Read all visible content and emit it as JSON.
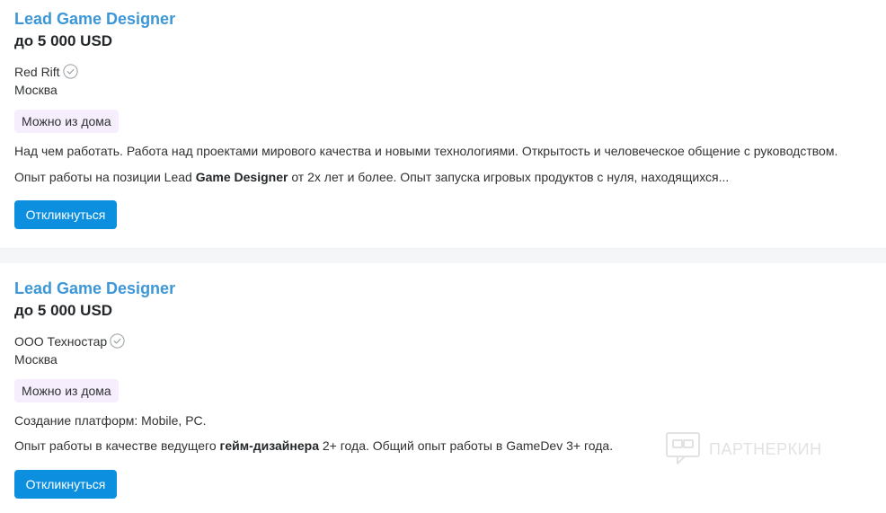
{
  "vacancies": [
    {
      "title": "Lead Game Designer",
      "salary": "до 5 000 USD",
      "company": "Red Rift",
      "city": "Москва",
      "badge": "Можно из дома",
      "line1": "Над чем работать. Работа над проектами мирового качества и новыми технологиями. Открытость и человеческое общение с руководством.",
      "line2_before": "Опыт работы на позиции Lead ",
      "line2_highlight": "Game Designer",
      "line2_after": " от 2х лет и более. Опыт запуска игровых продуктов с нуля, находящихся...",
      "apply_label": "Откликнуться"
    },
    {
      "title": "Lead Game Designer",
      "salary": "до 5 000 USD",
      "company": "ООО Техностар",
      "city": "Москва",
      "badge": "Можно из дома",
      "line1": "Создание платформ: Mobile, PC.",
      "line2_before": "Опыт работы в качестве ведущего ",
      "line2_highlight": "гейм-дизайнера",
      "line2_after": " 2+ года. Общий опыт работы в GameDev 3+ года.",
      "apply_label": "Откликнуться"
    }
  ],
  "watermark": {
    "text": "ПАРТНЕРКИН",
    "icon": "partnerkin-logo-icon"
  },
  "colors": {
    "title": "#3d97d6",
    "button": "#0d8fe0",
    "badge_bg": "#f6eefd",
    "separator": "#f4f6f7"
  }
}
